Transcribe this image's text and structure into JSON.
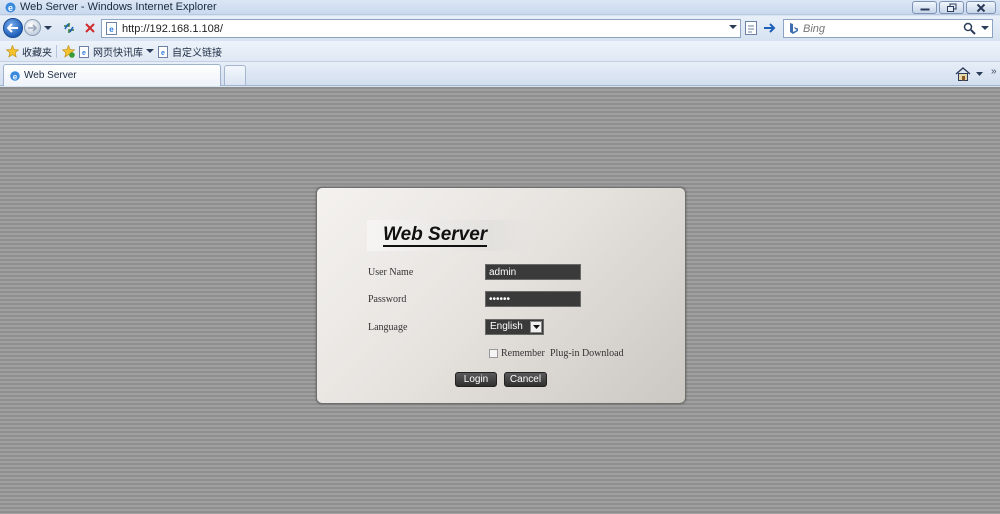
{
  "window": {
    "title": "Web Server - Windows Internet Explorer"
  },
  "navbar": {
    "address": "http://192.168.1.108/",
    "search_placeholder": "Bing"
  },
  "favorites": {
    "items": [
      {
        "label": "收藏夹",
        "icon": "star-icon"
      },
      {
        "label": "网页快讯库",
        "icon": "web-slice-icon"
      },
      {
        "label": "自定义链接",
        "icon": "ie-page-icon"
      }
    ]
  },
  "tabs": [
    {
      "label": "Web Server"
    }
  ],
  "login": {
    "logo": "Web Server",
    "username_label": "User Name",
    "username_value": "admin",
    "password_label": "Password",
    "password_value": "••••••",
    "language_label": "Language",
    "language_value": "English",
    "remember_label": "Remember",
    "plugin_link": "Plug-in Download",
    "login_button": "Login",
    "cancel_button": "Cancel"
  },
  "colors": {
    "accent": "#1f5fb8",
    "panel_bg": "#e7e4e0",
    "background_stripes": "#8e8e8e"
  }
}
